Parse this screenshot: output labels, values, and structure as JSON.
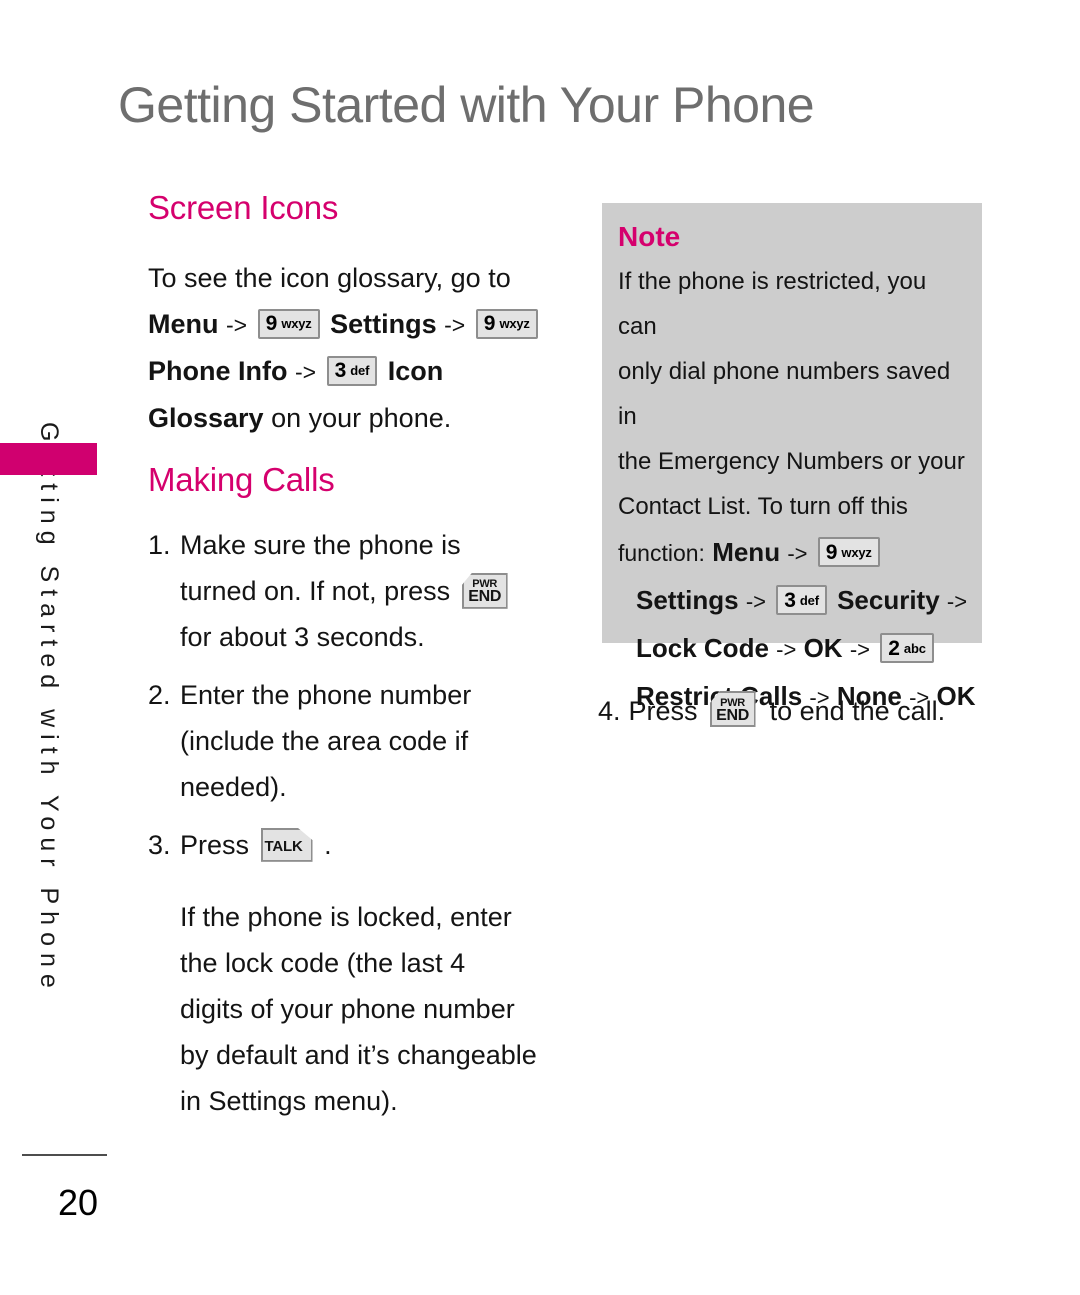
{
  "page": {
    "title": "Getting Started with Your Phone",
    "number": "20",
    "side_tab_label": "Getting Started with Your Phone",
    "accent_color": "#d5006d",
    "tab_color": "#d0006f",
    "title_color": "#6e6e6e",
    "note_bg_color": "#cdcdcd"
  },
  "left_column": {
    "section1": {
      "heading": "Screen Icons",
      "intro": "To see the icon glossary, go to",
      "sequence": {
        "menu": "Menu",
        "arrow1": "->",
        "key1": {
          "digit": "9",
          "letters": "wxyz",
          "name": "key-9-wxyz"
        },
        "settings": "Settings",
        "arrow2": "->",
        "key2": {
          "digit": "9",
          "letters": "wxyz",
          "name": "key-9-wxyz"
        },
        "phone_info": "Phone Info",
        "arrow3": "->",
        "key3": {
          "digit": "3",
          "letters": "def",
          "name": "key-3-def"
        },
        "icon": "Icon",
        "glossary": "Glossary",
        "tail": "on your phone."
      }
    },
    "section2": {
      "heading": "Making Calls",
      "steps": [
        {
          "num": "1.",
          "part1": "Make sure the phone is",
          "part2": "turned on. If not, press",
          "key": {
            "top": "PWR",
            "bottom": "END",
            "name": "key-pwr-end"
          },
          "part3": "for about 3 seconds."
        },
        {
          "num": "2.",
          "part1": "Enter the phone number",
          "part2": "(include the area code if",
          "part3": "needed)."
        },
        {
          "num": "3.",
          "part1": "Press",
          "key": {
            "label": "TALK",
            "name": "key-talk"
          },
          "part2": "."
        }
      ],
      "note_paragraph": [
        "If the phone is locked, enter",
        "the lock code (the last 4",
        "digits of your phone number",
        "by default and it’s changeable",
        "in Settings menu)."
      ]
    }
  },
  "right_column": {
    "note": {
      "heading": "Note",
      "lines": [
        "If the phone is restricted, you can",
        "only dial phone numbers saved in",
        "the Emergency Numbers or your",
        "Contact List. To turn off this"
      ],
      "sequence_line1": {
        "lead": "function:",
        "menu": "Menu",
        "arrow": "->",
        "key": {
          "digit": "9",
          "letters": "wxyz",
          "name": "key-9-wxyz"
        }
      },
      "sequence_line2": {
        "settings": "Settings",
        "arrow1": "->",
        "key": {
          "digit": "3",
          "letters": "def",
          "name": "key-3-def"
        },
        "security": "Security",
        "arrow2": "->"
      },
      "sequence_line3": {
        "lock_code": "Lock Code",
        "arrow1": "->",
        "ok": "OK",
        "arrow2": "->",
        "key": {
          "digit": "2",
          "letters": "abc",
          "name": "key-2-abc"
        }
      },
      "sequence_line4": {
        "restrict_calls": "Restrict Calls",
        "arrow1": "->",
        "none": "None",
        "arrow2": "->",
        "ok": "OK"
      }
    },
    "step4": {
      "num": "4.",
      "part1": "Press",
      "key": {
        "top": "PWR",
        "bottom": "END",
        "name": "key-pwr-end"
      },
      "part2": "to end the call."
    }
  }
}
